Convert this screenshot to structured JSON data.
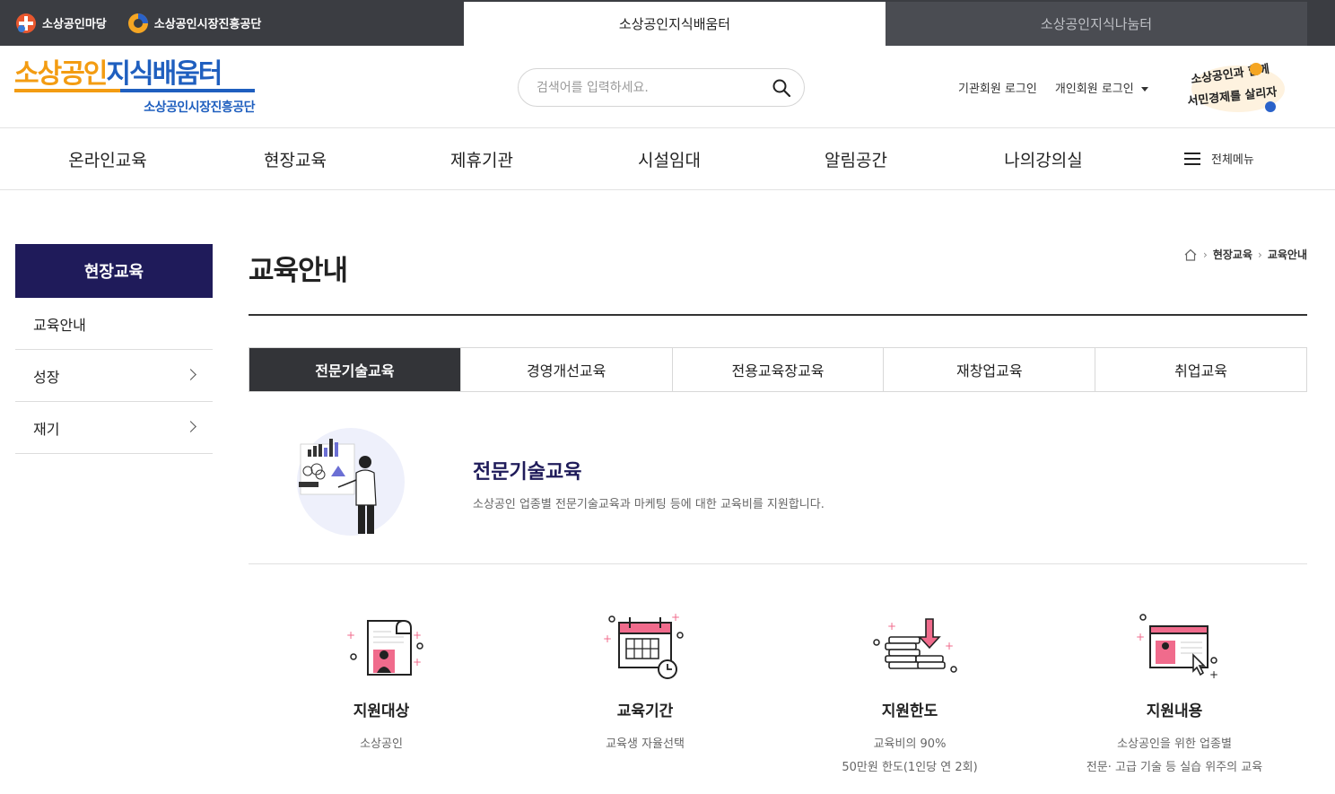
{
  "topbar": {
    "logo1_label": "소상공인마당",
    "logo2_label": "소상공인시장진흥공단",
    "tab_active": "소상공인지식배움터",
    "tab_other": "소상공인지식나눔터"
  },
  "header": {
    "brand_part1": "소상공인",
    "brand_part2": "지식배움터",
    "brand_sub": "소상공인시장진흥공단",
    "search_placeholder": "검색어를 입력하세요.",
    "login_org": "기관회원 로그인",
    "login_personal": "개인회원 로그인",
    "slogan_line1": "소상공인과 함께",
    "slogan_line2": "서민경제를 살리자"
  },
  "gnb": {
    "items": [
      "온라인교육",
      "현장교육",
      "제휴기관",
      "시설임대",
      "알림공간",
      "나의강의실"
    ],
    "all_menu": "전체메뉴"
  },
  "sidebar": {
    "title": "현장교육",
    "items": [
      {
        "label": "교육안내"
      },
      {
        "label": "성장"
      },
      {
        "label": "재기"
      }
    ]
  },
  "main": {
    "title": "교육안내",
    "breadcrumb": [
      "현장교육",
      "교육안내"
    ],
    "tabs": [
      "전문기술교육",
      "경영개선교육",
      "전용교육장교육",
      "재창업교육",
      "취업교육"
    ],
    "intro_title": "전문기술교육",
    "intro_desc": "소상공인 업종별 전문기술교육과 마케팅 등에 대한 교육비를 지원합니다.",
    "cards": [
      {
        "title": "지원대상",
        "desc1": "소상공인",
        "desc2": ""
      },
      {
        "title": "교육기간",
        "desc1": "교육생 자율선택",
        "desc2": ""
      },
      {
        "title": "지원한도",
        "desc1": "교육비의 90%",
        "desc2": "50만원 한도(1인당 연 2회)"
      },
      {
        "title": "지원내용",
        "desc1": "소상공인을 위한 업종별",
        "desc2": "전문· 고급 기술 등 실습 위주의 교육"
      }
    ]
  },
  "colors": {
    "topbar_bg": "#3b3d42",
    "brand_orange": "#f39c12",
    "brand_blue": "#1f5fbf",
    "sidebar_title_bg": "#1f1b5a",
    "active_tab_bg": "#333438",
    "icon_pink": "#f06b8c"
  }
}
